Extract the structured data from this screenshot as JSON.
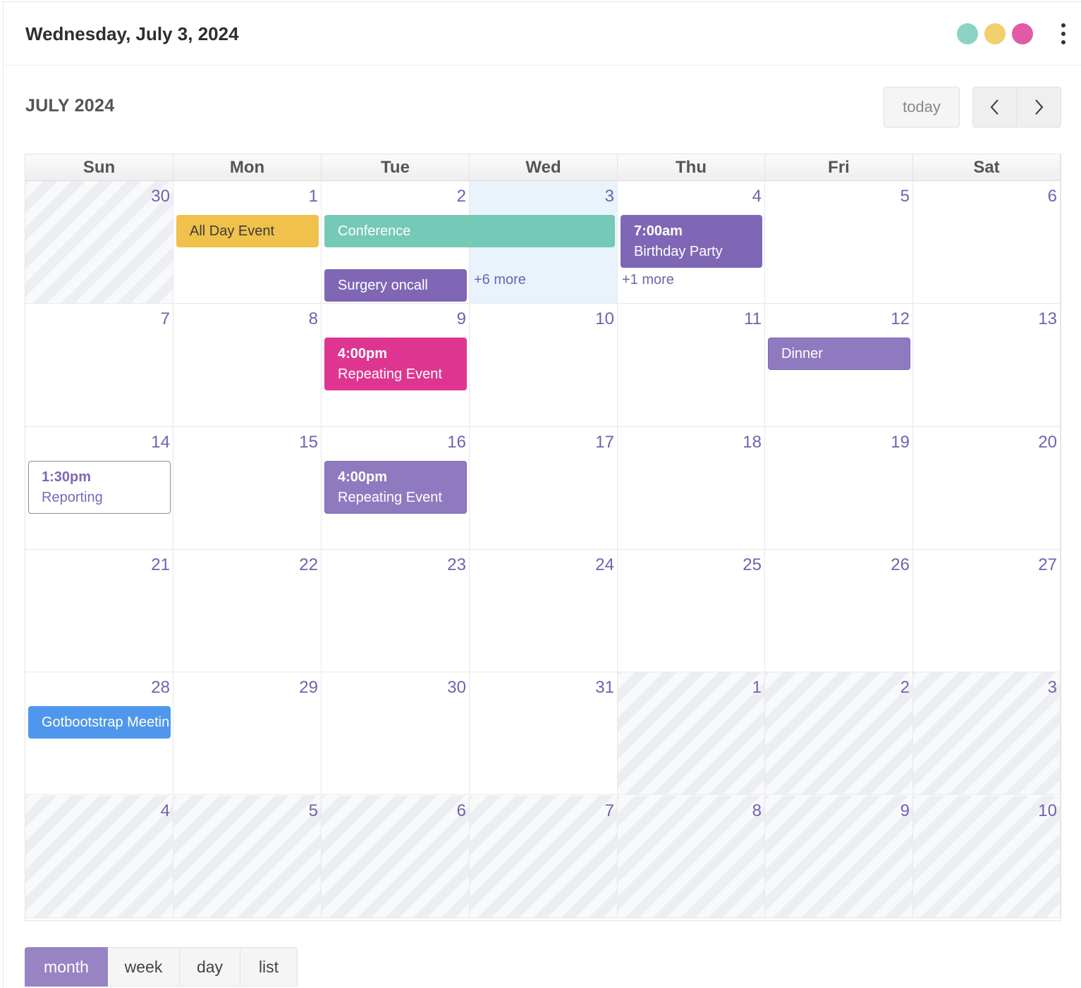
{
  "header": {
    "date": "Wednesday, July 3, 2024",
    "dots": [
      "#8dd3c4",
      "#f1cf6c",
      "#e25aa6"
    ]
  },
  "toolbar": {
    "title": "JULY 2024",
    "today_label": "today",
    "prev_icon": "chevron-left",
    "next_icon": "chevron-right"
  },
  "weekdays": [
    "Sun",
    "Mon",
    "Tue",
    "Wed",
    "Thu",
    "Fri",
    "Sat"
  ],
  "weeks": [
    [
      "30",
      "1",
      "2",
      "3",
      "4",
      "5",
      "6"
    ],
    [
      "7",
      "8",
      "9",
      "10",
      "11",
      "12",
      "13"
    ],
    [
      "14",
      "15",
      "16",
      "17",
      "18",
      "19",
      "20"
    ],
    [
      "21",
      "22",
      "23",
      "24",
      "25",
      "26",
      "27"
    ],
    [
      "28",
      "29",
      "30",
      "31",
      "1",
      "2",
      "3"
    ],
    [
      "4",
      "5",
      "6",
      "7",
      "8",
      "9",
      "10"
    ]
  ],
  "other_month": [
    [
      true,
      false,
      false,
      false,
      false,
      false,
      false
    ],
    [
      false,
      false,
      false,
      false,
      false,
      false,
      false
    ],
    [
      false,
      false,
      false,
      false,
      false,
      false,
      false
    ],
    [
      false,
      false,
      false,
      false,
      false,
      false,
      false
    ],
    [
      false,
      false,
      false,
      false,
      true,
      true,
      true
    ],
    [
      true,
      true,
      true,
      true,
      true,
      true,
      true
    ]
  ],
  "today_cell": {
    "week": 0,
    "day": 3
  },
  "events": [
    {
      "title": "All Day Event",
      "time": "",
      "week": 0,
      "day": 1,
      "span": 1,
      "slot": 0,
      "bg": "#f0c14b",
      "color": "#3b3b3b",
      "border": "#f0c14b"
    },
    {
      "title": "Conference",
      "time": "",
      "week": 0,
      "day": 2,
      "span": 2,
      "slot": 0,
      "bg": "#75c9b7",
      "color": "#ffffff",
      "border": "#75c9b7"
    },
    {
      "title": "Birthday Party",
      "time": "7:00am",
      "week": 0,
      "day": 4,
      "span": 1,
      "slot": 0,
      "bg": "#7f67b5",
      "color": "#ffffff",
      "border": "#7f67b5"
    },
    {
      "title": "Surgery oncall",
      "time": "",
      "week": 0,
      "day": 2,
      "span": 1,
      "slot": 1,
      "bg": "#7f67b5",
      "color": "#ffffff",
      "border": "#7f67b5"
    },
    {
      "title": "Repeating Event",
      "time": "4:00pm",
      "week": 1,
      "day": 2,
      "span": 1,
      "slot": 0,
      "bg": "#de3690",
      "color": "#ffffff",
      "border": "#de3690"
    },
    {
      "title": "Dinner",
      "time": "",
      "week": 1,
      "day": 5,
      "span": 1,
      "slot": 0,
      "bg": "#8f7ac0",
      "color": "#ffffff",
      "border": "#7f67b5"
    },
    {
      "title": "Reporting",
      "time": "1:30pm",
      "week": 2,
      "day": 0,
      "span": 1,
      "slot": 0,
      "bg": "#ffffff",
      "color": "#7f67b5",
      "border": "#8d8d8d"
    },
    {
      "title": "Repeating Event",
      "time": "4:00pm",
      "week": 2,
      "day": 2,
      "span": 1,
      "slot": 0,
      "bg": "#8f7ac0",
      "color": "#ffffff",
      "border": "#7f67b5"
    },
    {
      "title": "Gotbootstrap Meeting",
      "time": "",
      "week": 4,
      "day": 0,
      "span": 1,
      "slot": 0,
      "bg": "#4f97ec",
      "color": "#ffffff",
      "border": "#4f97ec"
    }
  ],
  "more_links": [
    {
      "label": "+6 more",
      "week": 0,
      "day": 3
    },
    {
      "label": "+1 more",
      "week": 0,
      "day": 4
    }
  ],
  "views": [
    {
      "label": "month",
      "active": true
    },
    {
      "label": "week",
      "active": false
    },
    {
      "label": "day",
      "active": false
    },
    {
      "label": "list",
      "active": false
    }
  ]
}
